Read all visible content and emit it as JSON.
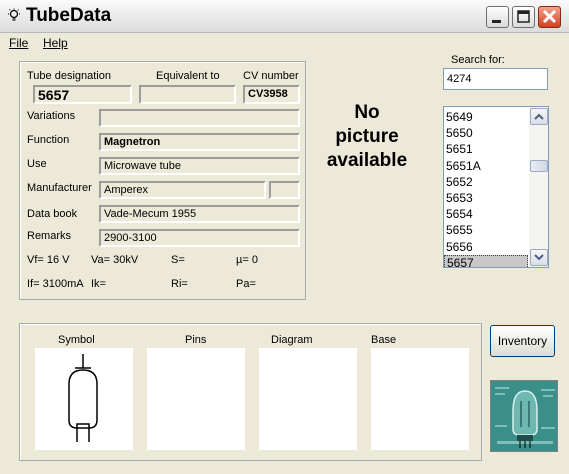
{
  "window": {
    "title": "TubeData"
  },
  "menu": {
    "file": "File",
    "help": "Help"
  },
  "labels": {
    "tube_designation": "Tube designation",
    "equivalent_to": "Equivalent to",
    "cv_number": "CV number",
    "variations": "Variations",
    "function": "Function",
    "use": "Use",
    "manufacturer": "Manufacturer",
    "data_book": "Data book",
    "remarks": "Remarks"
  },
  "values": {
    "tube_designation": "5657",
    "equivalent_to": "",
    "cv_number": "CV3958",
    "variations": "",
    "function": "Magnetron",
    "use": "Microwave tube",
    "manufacturer": "Amperex",
    "manufacturer_extra": "",
    "data_book": "Vade-Mecum 1955",
    "remarks": "2900-3100"
  },
  "parameters": {
    "vf": "Vf= 16 V",
    "va": "Va=  30kV",
    "s": "S=",
    "mu": "µ=    0",
    "if": "If= 3100mA",
    "ik": "Ik=",
    "ri": "Ri=",
    "pa": "Pa="
  },
  "search": {
    "label": "Search for:",
    "value": "4274"
  },
  "tube_list": {
    "items": [
      "5649",
      "5650",
      "5651",
      "5651A",
      "5652",
      "5653",
      "5654",
      "5655",
      "5656",
      "5657"
    ],
    "selected": "5657"
  },
  "picture": {
    "line1": "No",
    "line2": "picture",
    "line3": "available"
  },
  "bottom_panels": {
    "symbol": "Symbol",
    "pins": "Pins",
    "diagram": "Diagram",
    "base": "Base"
  },
  "buttons": {
    "inventory": "Inventory"
  },
  "colors": {
    "window_bg": "#ece9d8",
    "selection": "#c8c8c8",
    "close_button": "#d5401e",
    "logo_bg": "#2d7d7a"
  },
  "icons": {
    "app": "lightbulb-icon",
    "minimize": "minimize-icon",
    "maximize": "maximize-icon",
    "close": "close-icon",
    "scroll_up": "arrow-up-icon",
    "scroll_down": "arrow-down-icon",
    "symbol": "vacuum-tube-symbol",
    "logo": "tube-logo-icon"
  }
}
